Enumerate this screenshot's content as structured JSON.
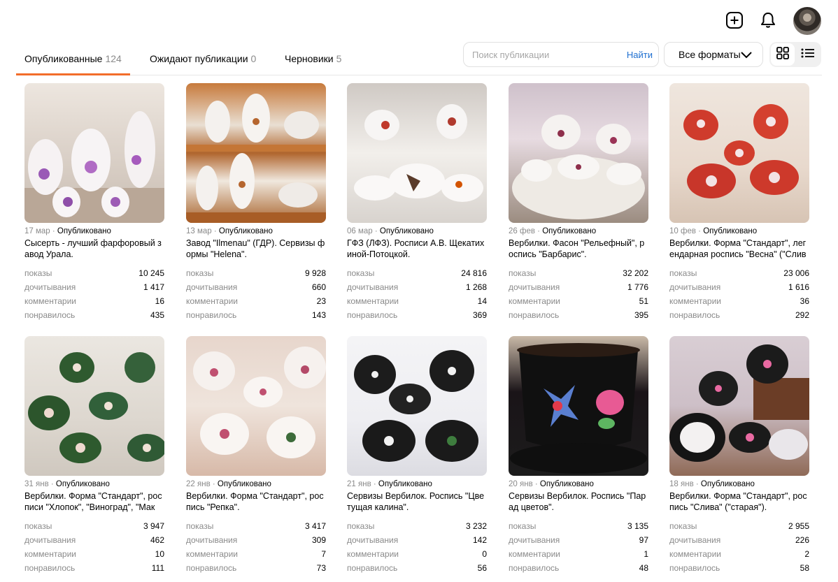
{
  "header": {
    "add_icon": "plus-square-icon",
    "bell_icon": "bell-icon",
    "avatar_icon": "user-avatar"
  },
  "tabs": [
    {
      "label": "Опубликованные",
      "count": "124"
    },
    {
      "label": "Ожидают публикации",
      "count": "0"
    },
    {
      "label": "Черновики",
      "count": "5"
    }
  ],
  "search": {
    "placeholder": "Поиск публикации",
    "button": "Найти"
  },
  "formats": {
    "label": "Все форматы"
  },
  "stat_labels": {
    "views": "показы",
    "reads": "дочитывания",
    "comments": "комментарии",
    "likes": "понравилось"
  },
  "colors": {
    "accent": "#f26d2a",
    "link": "#1e6fd0",
    "muted": "#8a8a8a"
  },
  "posts": [
    {
      "date": "17 мар",
      "status": "Опубликовано",
      "title": "Сысерть - лучший фарфоровый завод Урала.",
      "views": "10 245",
      "reads": "1 417",
      "comments": "16",
      "likes": "435"
    },
    {
      "date": "13 мар",
      "status": "Опубликовано",
      "title": "Завод \"Ilmenau\" (ГДР). Сервизы формы \"Helena\".",
      "views": "9 928",
      "reads": "660",
      "comments": "23",
      "likes": "143"
    },
    {
      "date": "06 мар",
      "status": "Опубликовано",
      "title": "ГФЗ (ЛФЗ). Росписи А.В. Щекатихиной-Потоцкой.",
      "views": "24 816",
      "reads": "1 268",
      "comments": "14",
      "likes": "369"
    },
    {
      "date": "26 фев",
      "status": "Опубликовано",
      "title": "Вербилки. Фасон \"Рельефный\", роспись \"Барбарис\".",
      "views": "32 202",
      "reads": "1 776",
      "comments": "51",
      "likes": "395"
    },
    {
      "date": "10 фев",
      "status": "Опубликовано",
      "title": "Вербилки. Форма \"Стандарт\", легендарная роспись \"Весна\" (\"Слива\", ...",
      "views": "23 006",
      "reads": "1 616",
      "comments": "36",
      "likes": "292"
    },
    {
      "date": "31 янв",
      "status": "Опубликовано",
      "title": "Вербилки. Форма \"Стандарт\", росписи \"Хлопок\", \"Виноград\", \"Маки\",...",
      "views": "3 947",
      "reads": "462",
      "comments": "10",
      "likes": "111"
    },
    {
      "date": "22 янв",
      "status": "Опубликовано",
      "title": "Вербилки. Форма \"Стандарт\", роспись \"Репка\".",
      "views": "3 417",
      "reads": "309",
      "comments": "7",
      "likes": "73"
    },
    {
      "date": "21 янв",
      "status": "Опубликовано",
      "title": "Сервизы Вербилок. Роспись \"Цветущая калина\".",
      "views": "3 232",
      "reads": "142",
      "comments": "0",
      "likes": "56"
    },
    {
      "date": "20 янв",
      "status": "Опубликовано",
      "title": "Сервизы Вербилок. Роспись \"Парад цветов\".",
      "views": "3 135",
      "reads": "97",
      "comments": "1",
      "likes": "48"
    },
    {
      "date": "18 янв",
      "status": "Опубликовано",
      "title": "Вербилки. Форма \"Стандарт\", роспись \"Слива\" (\"старая\").",
      "views": "2 955",
      "reads": "226",
      "comments": "2",
      "likes": "58"
    }
  ]
}
